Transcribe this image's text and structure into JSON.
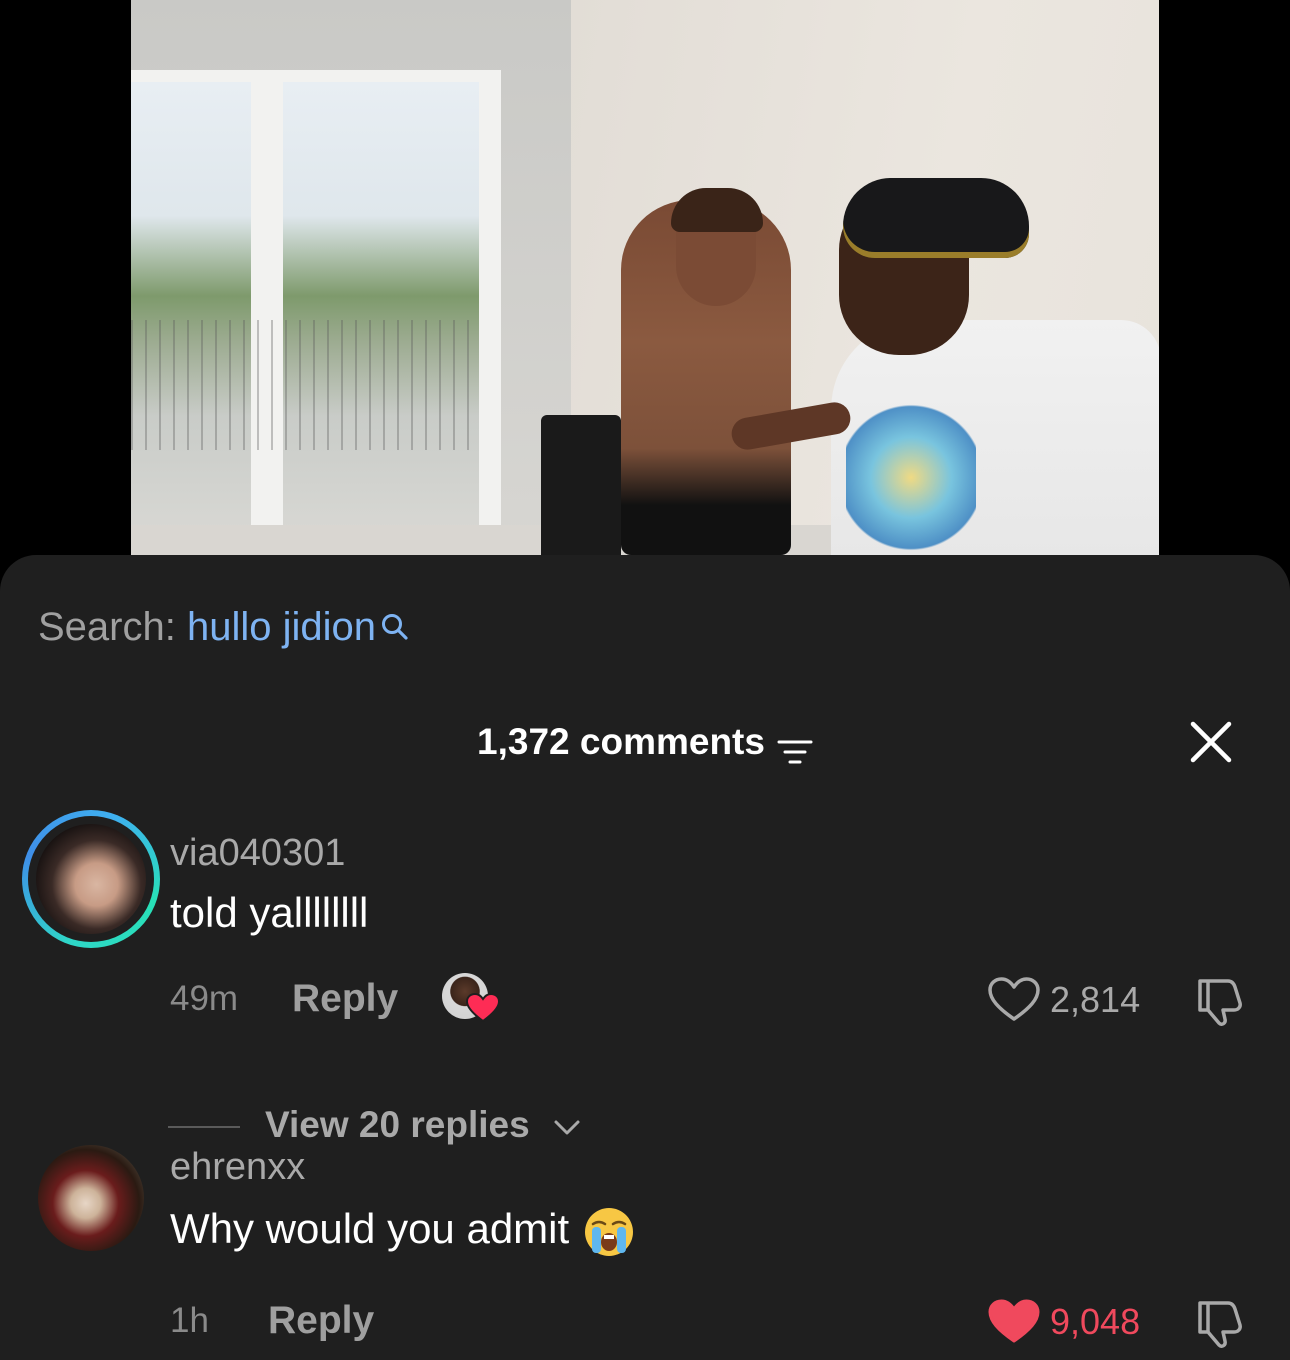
{
  "search": {
    "prefix": "Search: ",
    "query": "hullo jidion"
  },
  "header": {
    "comments_count": "1,372 comments"
  },
  "comments": [
    {
      "username": "via040301",
      "text": "told yallllllll",
      "time": "49m",
      "reply_label": "Reply",
      "likes": "2,814",
      "liked": false,
      "creator_liked": true,
      "view_replies": "View 20 replies"
    },
    {
      "username": "ehrenxx",
      "text": "Why would you admit",
      "time": "1h",
      "reply_label": "Reply",
      "likes": "9,048",
      "liked": true
    }
  ],
  "colors": {
    "sheet_bg": "#1f1f1f",
    "search_query": "#7eb3f2",
    "like_active": "#f0495d",
    "muted_text": "#a9a9a9"
  },
  "icons": {
    "search": "search-icon",
    "filter": "filter-icon",
    "close": "close-icon",
    "heart": "heart-icon",
    "dislike": "thumbs-down-icon",
    "chevron": "chevron-down-icon",
    "emoji": "crying-face-emoji"
  }
}
